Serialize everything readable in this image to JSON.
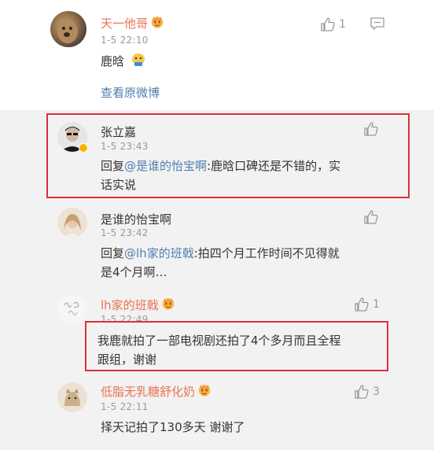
{
  "main_comment": {
    "user": "天一他哥",
    "time": "1-5 22:10",
    "text": "鹿晗",
    "like_count": "1",
    "view_original": "查看原微博"
  },
  "replies": [
    {
      "user": "张立嘉",
      "time": "1-5 23:43",
      "reply_prefix": "回复",
      "mention": "@是谁的怡宝啊",
      "line1": ":鹿晗口碑还是不错的，实",
      "line2": "话实说",
      "like_count": ""
    },
    {
      "user": "是谁的怡宝啊",
      "time": "1-5 23:42",
      "reply_prefix": "回复",
      "mention": "@lh家的班戟",
      "line1": ":拍四个月工作时间不见得就",
      "line2": "是4个月啊…",
      "like_count": ""
    },
    {
      "user": "lh家的班戟",
      "time": "1-5 22:49",
      "line1": "我鹿就拍了一部电视剧还拍了4个多月而且全程",
      "line2": "跟组，谢谢",
      "like_count": "1"
    },
    {
      "user": "低脂无乳糖舒化奶",
      "time": "1-5 22:11",
      "line1": "择天记拍了130多天 谢谢了",
      "like_count": "3"
    }
  ],
  "colors": {
    "name_orange": "#eb7350",
    "link_blue": "#507daf",
    "highlight_red": "#d8323c",
    "meta_gray": "#999999"
  },
  "icons": [
    "thumbs-up-icon",
    "reply-icon",
    "vip-emoji-icon",
    "verified-badge-icon"
  ]
}
